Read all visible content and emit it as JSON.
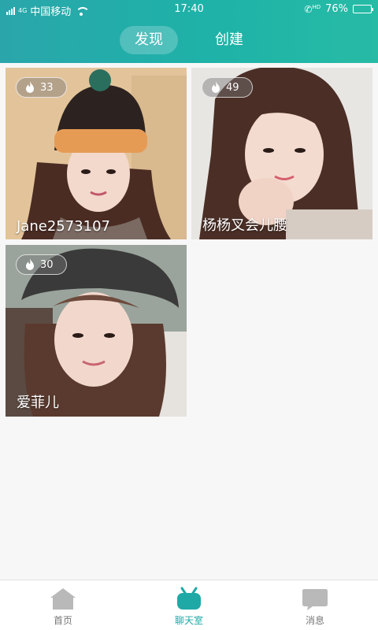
{
  "status_bar": {
    "network_tag": "4G",
    "carrier": "中国移动",
    "time": "17:40",
    "call_tag": "HD",
    "battery": "76%",
    "battery_level": 0.76
  },
  "tabs": [
    {
      "label": "发现",
      "active": true
    },
    {
      "label": "创建",
      "active": false
    }
  ],
  "cards": [
    {
      "name": "Jane2573107",
      "heat": "33"
    },
    {
      "name": "杨杨叉会儿腰",
      "heat": "49"
    },
    {
      "name": "爱菲儿",
      "heat": "30"
    }
  ],
  "bottom_nav": [
    {
      "label": "首页",
      "icon": "home-icon",
      "active": false
    },
    {
      "label": "聊天室",
      "icon": "chatroom-icon",
      "active": true
    },
    {
      "label": "消息",
      "icon": "message-icon",
      "active": false
    }
  ],
  "colors": {
    "header_start": "#2aa6ab",
    "header_end": "#27bba6",
    "accent": "#1fa9a6",
    "inactive_icon": "#b9b9b9"
  }
}
